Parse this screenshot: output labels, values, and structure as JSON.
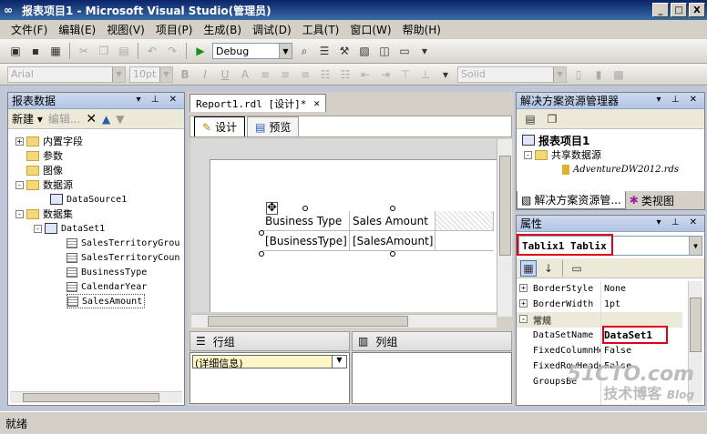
{
  "window": {
    "title": "报表项目1 - Microsoft Visual Studio(管理员)",
    "min": "_",
    "max": "□",
    "close": "X"
  },
  "menu": [
    "文件(F)",
    "编辑(E)",
    "视图(V)",
    "项目(P)",
    "生成(B)",
    "调试(D)",
    "工具(T)",
    "窗口(W)",
    "帮助(H)"
  ],
  "toolbar": {
    "config": "Debug",
    "font": "Arial",
    "size": "10pt",
    "border_style": "Solid"
  },
  "left_panel": {
    "title": "报表数据",
    "new_label": "新建",
    "edit_label": "编辑...",
    "tree": {
      "builtin": "内置字段",
      "params": "参数",
      "images": "图像",
      "datasources": "数据源",
      "datasource1": "DataSource1",
      "datasets": "数据集",
      "dataset1": "DataSet1",
      "fields": [
        "SalesTerritoryGrou",
        "SalesTerritoryCoun",
        "BusinessType",
        "CalendarYear",
        "SalesAmount"
      ]
    }
  },
  "document": {
    "tab": "Report1.rdl [设计]*",
    "design_tab": "设计",
    "preview_tab": "预览",
    "tablix": {
      "headers": [
        "Business Type",
        "Sales Amount"
      ],
      "values": [
        "[BusinessType]",
        "[SalesAmount]"
      ]
    },
    "row_groups_label": "行组",
    "col_groups_label": "列组",
    "details_group": "(详细信息)"
  },
  "solution": {
    "title": "解决方案资源管理器",
    "project": "报表项目1",
    "shared_ds": "共享数据源",
    "ds_file": "AdventureDW2012.rds",
    "tab1": "解决方案资源管...",
    "tab2": "类视图"
  },
  "properties": {
    "title": "属性",
    "object": "Tablix1 Tablix",
    "category": "常规",
    "rows": [
      {
        "name": "BorderStyle",
        "value": "None",
        "exp": "+"
      },
      {
        "name": "BorderWidth",
        "value": "1pt",
        "exp": "+"
      },
      {
        "name": "DataSetName",
        "value": "DataSet1",
        "exp": ""
      },
      {
        "name": "FixedColumnHe",
        "value": "False",
        "exp": ""
      },
      {
        "name": "FixedRowHeade",
        "value": "False",
        "exp": ""
      },
      {
        "name": "GroupsBe",
        "value": "",
        "exp": ""
      }
    ]
  },
  "status": "就绪",
  "watermark": {
    "line1": "51CTO.com",
    "line2": "技术博客",
    "line3": "Blog"
  }
}
